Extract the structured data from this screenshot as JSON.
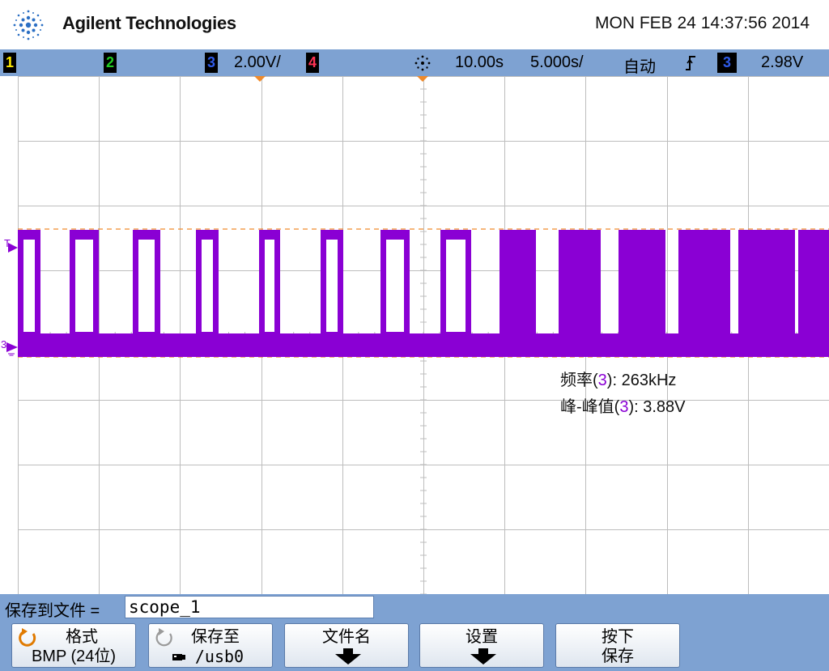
{
  "header": {
    "brand": "Agilent Technologies",
    "datetime": "MON FEB 24 14:37:56 2014"
  },
  "status": {
    "ch1": "1",
    "ch2": "2",
    "ch3": "3",
    "ch3_scale": "2.00V/",
    "ch4": "4",
    "time_delay": "10.00ѕ",
    "time_scale": "5.000ѕ/",
    "trigger_mode": "自动",
    "trigger_source": "3",
    "trigger_level": "2.98V",
    "colors": {
      "ch1": "#ffea00",
      "ch2": "#22cc22",
      "ch3": "#2f5be8",
      "ch4": "#ff3355",
      "trace": "#8a00d4"
    }
  },
  "markers": {
    "trigger_marker": "T",
    "ground_marker": "3"
  },
  "measurements": {
    "freq_label": "频率(",
    "freq_ch": "3",
    "freq_rest": "): 263kHz",
    "vpp_label": "峰-峰值(",
    "vpp_ch": "3",
    "vpp_rest": "): 3.88V"
  },
  "save": {
    "label": "保存到文件 =",
    "filename": "scope_1"
  },
  "softkeys": {
    "format_l1": "格式",
    "format_l2": "BMP (24位)",
    "saveto_l1": "保存至",
    "saveto_l2": "/usb0",
    "filename_l1": "文件名",
    "settings_l1": "设置",
    "press_l1": "按下",
    "press_l2": "保存"
  },
  "icons": {
    "logo": "agilent-spark-icon",
    "trigger_slope": "rising-edge-icon",
    "run": "run-star-icon",
    "cycle": "cycle-arrow-icon",
    "down": "down-arrow-icon",
    "usb": "usb-icon"
  }
}
